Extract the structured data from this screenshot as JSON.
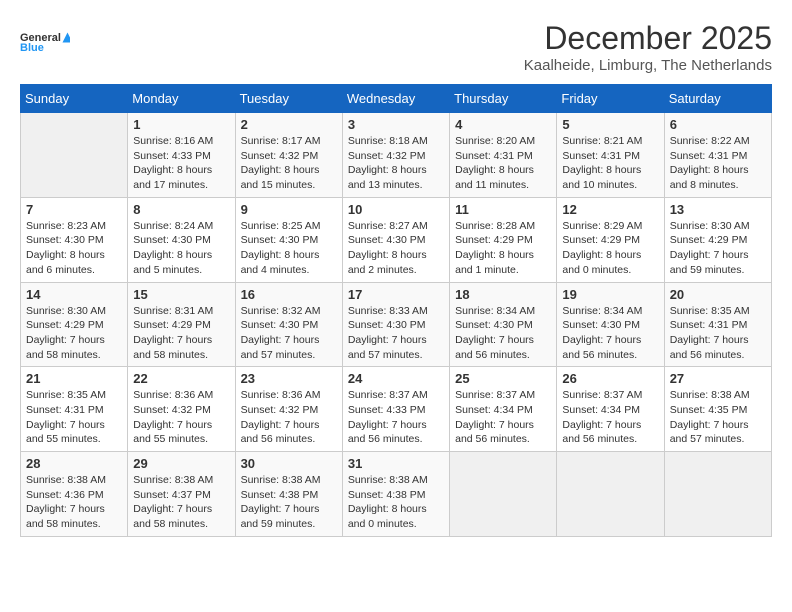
{
  "logo": {
    "text_general": "General",
    "text_blue": "Blue"
  },
  "header": {
    "month_year": "December 2025",
    "location": "Kaalheide, Limburg, The Netherlands"
  },
  "days_of_week": [
    "Sunday",
    "Monday",
    "Tuesday",
    "Wednesday",
    "Thursday",
    "Friday",
    "Saturday"
  ],
  "weeks": [
    [
      {
        "day": "",
        "info": ""
      },
      {
        "day": "1",
        "info": "Sunrise: 8:16 AM\nSunset: 4:33 PM\nDaylight: 8 hours\nand 17 minutes."
      },
      {
        "day": "2",
        "info": "Sunrise: 8:17 AM\nSunset: 4:32 PM\nDaylight: 8 hours\nand 15 minutes."
      },
      {
        "day": "3",
        "info": "Sunrise: 8:18 AM\nSunset: 4:32 PM\nDaylight: 8 hours\nand 13 minutes."
      },
      {
        "day": "4",
        "info": "Sunrise: 8:20 AM\nSunset: 4:31 PM\nDaylight: 8 hours\nand 11 minutes."
      },
      {
        "day": "5",
        "info": "Sunrise: 8:21 AM\nSunset: 4:31 PM\nDaylight: 8 hours\nand 10 minutes."
      },
      {
        "day": "6",
        "info": "Sunrise: 8:22 AM\nSunset: 4:31 PM\nDaylight: 8 hours\nand 8 minutes."
      }
    ],
    [
      {
        "day": "7",
        "info": "Sunrise: 8:23 AM\nSunset: 4:30 PM\nDaylight: 8 hours\nand 6 minutes."
      },
      {
        "day": "8",
        "info": "Sunrise: 8:24 AM\nSunset: 4:30 PM\nDaylight: 8 hours\nand 5 minutes."
      },
      {
        "day": "9",
        "info": "Sunrise: 8:25 AM\nSunset: 4:30 PM\nDaylight: 8 hours\nand 4 minutes."
      },
      {
        "day": "10",
        "info": "Sunrise: 8:27 AM\nSunset: 4:30 PM\nDaylight: 8 hours\nand 2 minutes."
      },
      {
        "day": "11",
        "info": "Sunrise: 8:28 AM\nSunset: 4:29 PM\nDaylight: 8 hours\nand 1 minute."
      },
      {
        "day": "12",
        "info": "Sunrise: 8:29 AM\nSunset: 4:29 PM\nDaylight: 8 hours\nand 0 minutes."
      },
      {
        "day": "13",
        "info": "Sunrise: 8:30 AM\nSunset: 4:29 PM\nDaylight: 7 hours\nand 59 minutes."
      }
    ],
    [
      {
        "day": "14",
        "info": "Sunrise: 8:30 AM\nSunset: 4:29 PM\nDaylight: 7 hours\nand 58 minutes."
      },
      {
        "day": "15",
        "info": "Sunrise: 8:31 AM\nSunset: 4:29 PM\nDaylight: 7 hours\nand 58 minutes."
      },
      {
        "day": "16",
        "info": "Sunrise: 8:32 AM\nSunset: 4:30 PM\nDaylight: 7 hours\nand 57 minutes."
      },
      {
        "day": "17",
        "info": "Sunrise: 8:33 AM\nSunset: 4:30 PM\nDaylight: 7 hours\nand 57 minutes."
      },
      {
        "day": "18",
        "info": "Sunrise: 8:34 AM\nSunset: 4:30 PM\nDaylight: 7 hours\nand 56 minutes."
      },
      {
        "day": "19",
        "info": "Sunrise: 8:34 AM\nSunset: 4:30 PM\nDaylight: 7 hours\nand 56 minutes."
      },
      {
        "day": "20",
        "info": "Sunrise: 8:35 AM\nSunset: 4:31 PM\nDaylight: 7 hours\nand 56 minutes."
      }
    ],
    [
      {
        "day": "21",
        "info": "Sunrise: 8:35 AM\nSunset: 4:31 PM\nDaylight: 7 hours\nand 55 minutes."
      },
      {
        "day": "22",
        "info": "Sunrise: 8:36 AM\nSunset: 4:32 PM\nDaylight: 7 hours\nand 55 minutes."
      },
      {
        "day": "23",
        "info": "Sunrise: 8:36 AM\nSunset: 4:32 PM\nDaylight: 7 hours\nand 56 minutes."
      },
      {
        "day": "24",
        "info": "Sunrise: 8:37 AM\nSunset: 4:33 PM\nDaylight: 7 hours\nand 56 minutes."
      },
      {
        "day": "25",
        "info": "Sunrise: 8:37 AM\nSunset: 4:34 PM\nDaylight: 7 hours\nand 56 minutes."
      },
      {
        "day": "26",
        "info": "Sunrise: 8:37 AM\nSunset: 4:34 PM\nDaylight: 7 hours\nand 56 minutes."
      },
      {
        "day": "27",
        "info": "Sunrise: 8:38 AM\nSunset: 4:35 PM\nDaylight: 7 hours\nand 57 minutes."
      }
    ],
    [
      {
        "day": "28",
        "info": "Sunrise: 8:38 AM\nSunset: 4:36 PM\nDaylight: 7 hours\nand 58 minutes."
      },
      {
        "day": "29",
        "info": "Sunrise: 8:38 AM\nSunset: 4:37 PM\nDaylight: 7 hours\nand 58 minutes."
      },
      {
        "day": "30",
        "info": "Sunrise: 8:38 AM\nSunset: 4:38 PM\nDaylight: 7 hours\nand 59 minutes."
      },
      {
        "day": "31",
        "info": "Sunrise: 8:38 AM\nSunset: 4:38 PM\nDaylight: 8 hours\nand 0 minutes."
      },
      {
        "day": "",
        "info": ""
      },
      {
        "day": "",
        "info": ""
      },
      {
        "day": "",
        "info": ""
      }
    ]
  ]
}
